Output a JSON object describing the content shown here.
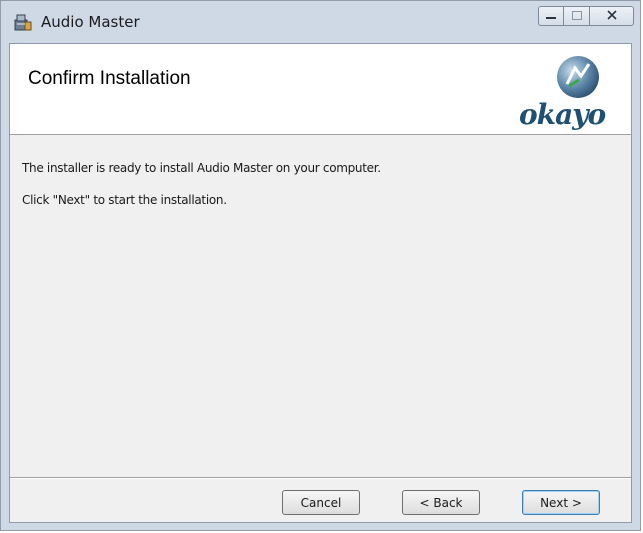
{
  "window": {
    "title": "Audio Master",
    "controls": {
      "minimize": "minimize",
      "maximize": "maximize",
      "close": "close"
    }
  },
  "header": {
    "title": "Confirm Installation",
    "logo_text": "okayo"
  },
  "body": {
    "line1": "The installer is ready to install Audio Master on your computer.",
    "line2": "Click \"Next\" to start the installation."
  },
  "buttons": {
    "cancel": "Cancel",
    "back": "< Back",
    "next": "Next >"
  },
  "colors": {
    "title_bar": "#cfd9e6",
    "client_bg": "#f0f0f0",
    "logo": "#1f4f73",
    "default_button_border": "#3c7fb1"
  },
  "icons": [
    "installer-app-icon",
    "minimize-icon",
    "maximize-icon",
    "close-icon",
    "okayo-logo-icon"
  ]
}
